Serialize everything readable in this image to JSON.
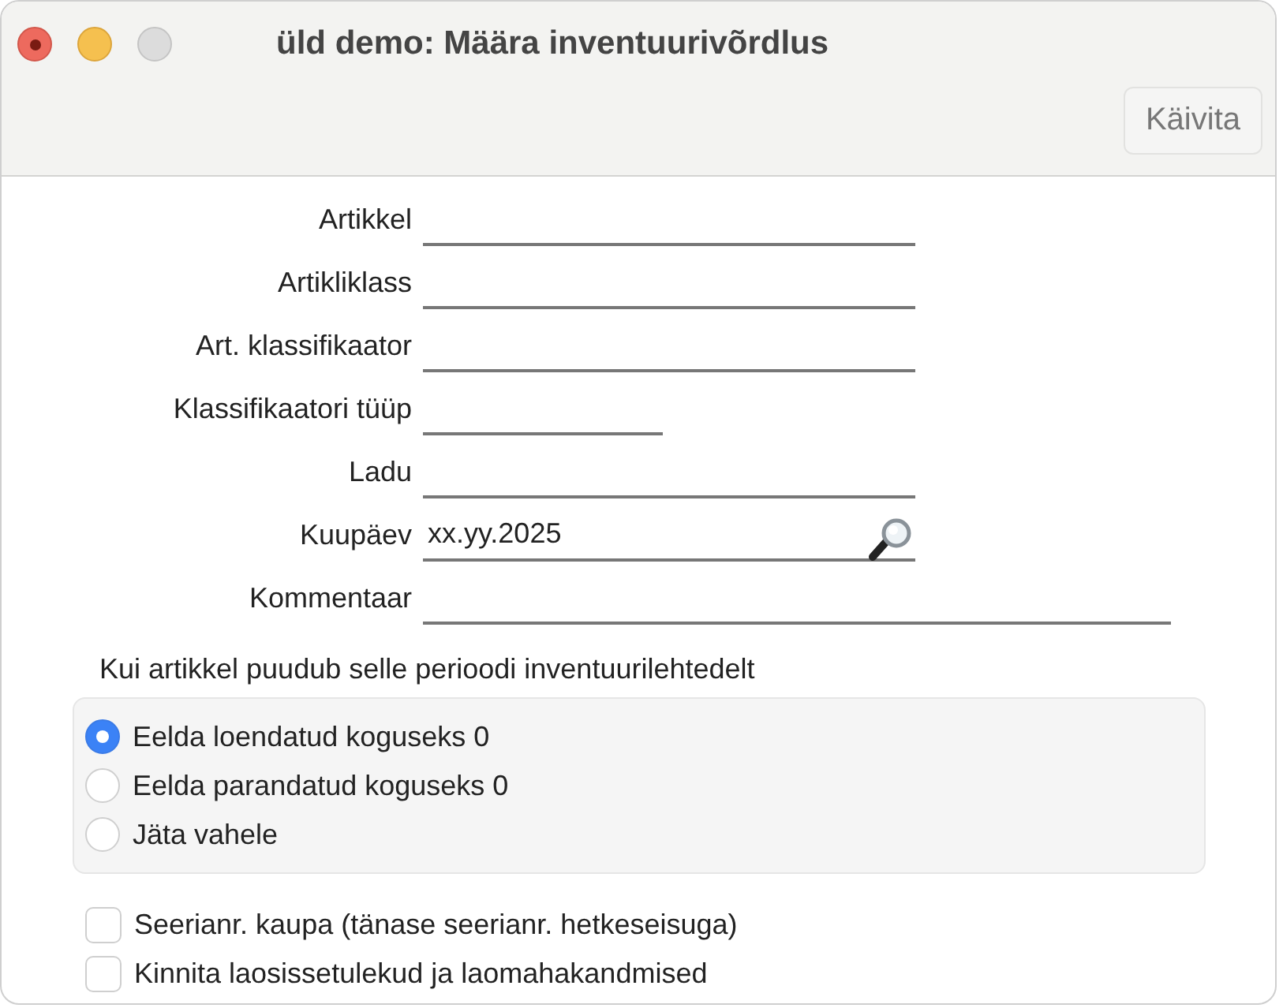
{
  "window": {
    "title": "üld demo: Määra inventuurivõrdlus"
  },
  "toolbar": {
    "buttons": [
      {
        "label": "Käivita",
        "disabled": true
      }
    ]
  },
  "fields": [
    {
      "label": "Artikkel",
      "kind": "medium"
    },
    {
      "label": "Artikliklass",
      "kind": "medium"
    },
    {
      "label": "Art. klassifikaator",
      "kind": "medium"
    },
    {
      "label": "Klassifikaatori tüüp",
      "kind": "short"
    },
    {
      "label": "Ladu",
      "kind": "medium"
    },
    {
      "label": "Kuupäev",
      "kind": "medium",
      "value": "xx.yy.2025",
      "lookup": true
    },
    {
      "label": "Kommentaar",
      "kind": "long"
    }
  ],
  "missing_article": {
    "heading": "Kui artikkel puudub selle perioodi inventuurilehtedelt",
    "options": [
      {
        "label": "Eelda loendatud koguseks 0",
        "selected": true
      },
      {
        "label": "Eelda parandatud koguseks 0",
        "selected": false
      },
      {
        "label": "Jäta vahele",
        "selected": false
      }
    ]
  },
  "checkboxes": [
    {
      "label": "Seerianr. kaupa (tänase seerianr. hetkeseisuga)",
      "checked": false
    },
    {
      "label": "Kinnita laosissetulekud ja laomahakandmised",
      "checked": false
    }
  ]
}
